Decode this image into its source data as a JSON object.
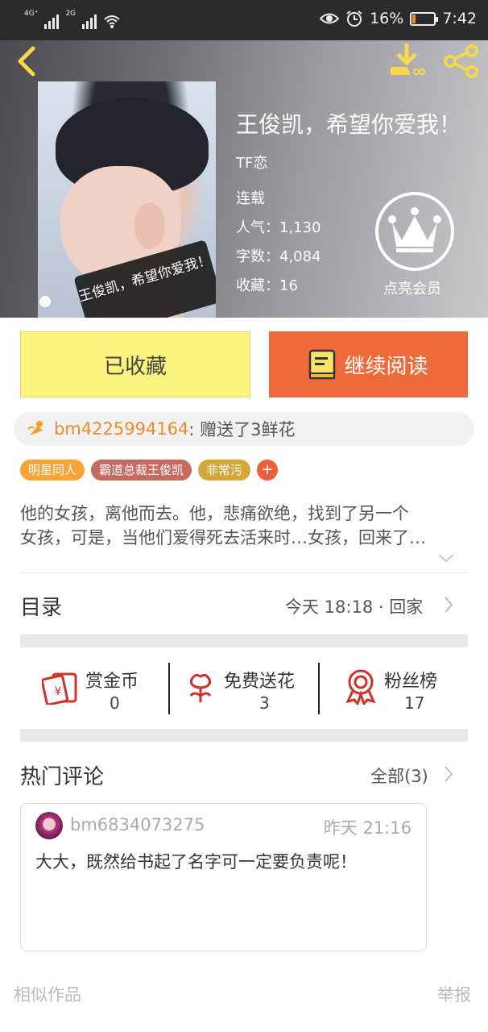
{
  "status_bar": {
    "signal1_label": "4G⁺",
    "signal2_label": "2G",
    "battery_percent_text": "16%",
    "battery_level": 0.16,
    "time": "7:42"
  },
  "book": {
    "title": "王俊凯，希望你爱我！",
    "cover_label": "王俊凯，希望你爱我！",
    "author": "TF恋",
    "status": "连载",
    "stats": [
      {
        "label": "人气：",
        "value": "1,130"
      },
      {
        "label": "字数：",
        "value": "4,084"
      },
      {
        "label": "收藏：",
        "value": "16"
      }
    ],
    "vip_label": "点亮会员"
  },
  "actions": {
    "favorited_label": "已收藏",
    "continue_label": "继续阅读"
  },
  "gift": {
    "user": "bm4225994164",
    "message": " : 赠送了3鲜花"
  },
  "tags": [
    {
      "label": "明星同人",
      "color": "#f5a43a"
    },
    {
      "label": "霸道总裁王俊凯",
      "color": "#c56b60"
    },
    {
      "label": "非常污",
      "color": "#d4a73a"
    }
  ],
  "description_lines": [
    "他的女孩，离他而去。他，悲痛欲绝，找到了另一个",
    "女孩，可是，当他们爱得死去活来时…女孩，回来了…"
  ],
  "toc": {
    "title": "目录",
    "latest": "今天 18:18 · 回家"
  },
  "rewards": [
    {
      "label": "赏金币",
      "value": "0",
      "icon": "red-envelope-icon"
    },
    {
      "label": "免费送花",
      "value": "3",
      "icon": "flower-icon"
    },
    {
      "label": "粉丝榜",
      "value": "17",
      "icon": "medal-icon"
    }
  ],
  "comments_section": {
    "title": "热门评论",
    "all_label": "全部(3)",
    "items": [
      {
        "user": "bm6834073275",
        "time": "昨天 21:16",
        "text": "大大，既然给书起了名字可一定要负责呢！"
      }
    ]
  },
  "footer": {
    "similar_label": "相似作品",
    "report_label": "举报"
  },
  "colors": {
    "accent_orange": "#ef6a3b",
    "favorited_yellow": "#fbf37d",
    "icon_yellow": "#f6d84a",
    "reward_red": "#d0322b"
  }
}
